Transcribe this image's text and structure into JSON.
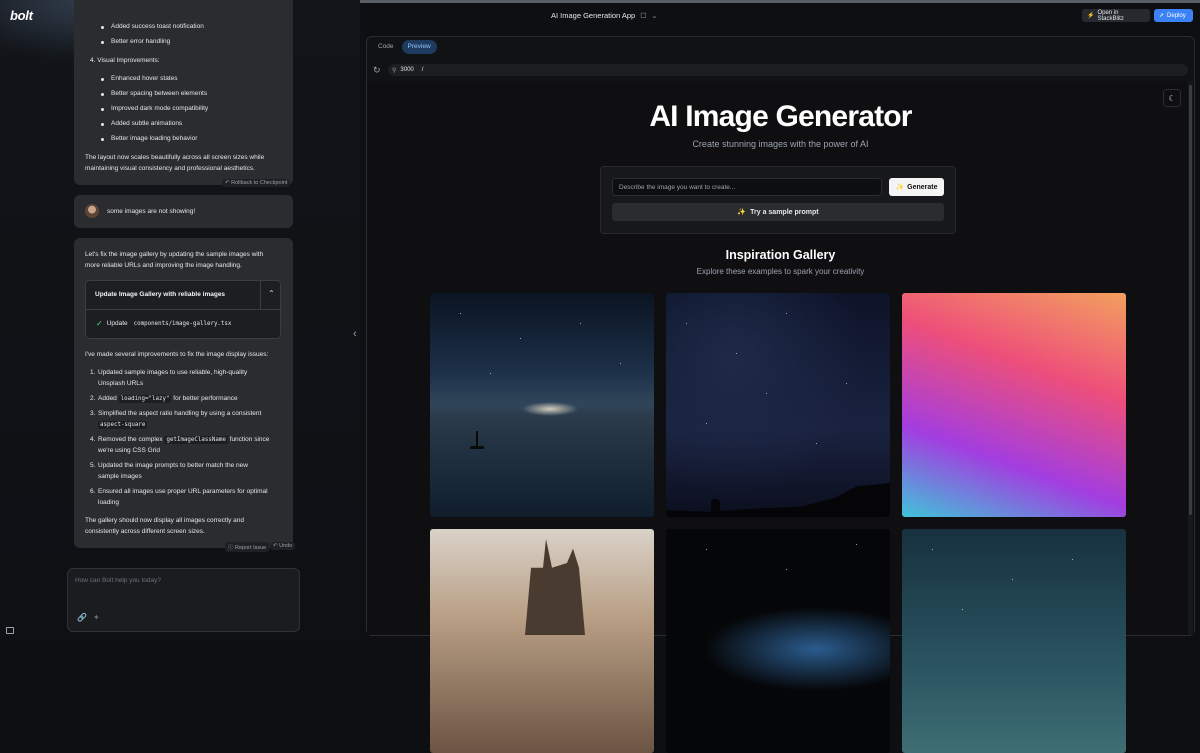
{
  "app": {
    "logo": "bolt",
    "title": "AI Image Generation App"
  },
  "header": {
    "stackblitz": "Open in StackBlitz",
    "deploy": "Deploy"
  },
  "chat": {
    "msg1": {
      "partial_item": "Added success toast notification",
      "item_error": "Better error handling",
      "section4": "4.  Visual Improvements:",
      "bullets": [
        "Enhanced hover states",
        "Better spacing between elements",
        "Improved dark mode compatibility",
        "Added subtle animations",
        "Better image loading behavior"
      ],
      "summary_l1": "The layout now scales beautifully across all screen sizes while",
      "summary_l2": "maintaining visual consistency and professional aesthetics.",
      "rollback": "Rollback to Checkpoint"
    },
    "user_msg": "some images are not showing!",
    "msg2": {
      "intro_l1": "Let's fix the image gallery by updating the sample images with",
      "intro_l2": "more reliable URLs and improving the image handling.",
      "artifact_title": "Update Image Gallery with reliable images",
      "artifact_action": "Update",
      "artifact_file": "components/image-gallery.tsx",
      "improvements_intro": "I've made several improvements to fix the image display issues:",
      "items": [
        {
          "n": "1.",
          "l1": "Updated sample images to use reliable, high-quality",
          "l2": "Unsplash URLs"
        },
        {
          "n": "2.",
          "a": "Added ",
          "code": "loading=\"lazy\"",
          "b": " for better performance"
        },
        {
          "n": "3.",
          "l1": "Simplified the aspect ratio handling by using a consistent",
          "code": "aspect-square"
        },
        {
          "n": "4.",
          "a": "Removed the complex ",
          "code": "getImageClassName",
          "b": " function since",
          "l2": "we're using CSS Grid"
        },
        {
          "n": "5.",
          "l1": "Updated the image prompts to better match the new",
          "l2": "sample images"
        },
        {
          "n": "6.",
          "l1": "Ensured all images use proper URL parameters for optimal",
          "l2": "loading"
        }
      ],
      "closing_l1": "The gallery should now display all images correctly and",
      "closing_l2": "consistently across different screen sizes.",
      "report": "Report Issue",
      "undo": "Undo"
    },
    "input_placeholder": "How can Bolt help you today?"
  },
  "preview": {
    "tabs": [
      "Code",
      "Preview"
    ],
    "active_tab": "Preview",
    "port": "3000",
    "path": "/",
    "title": "AI Image Generator",
    "subtitle": "Create stunning images with the power of AI",
    "prompt_placeholder": "Describe the image you want to create...",
    "generate": "Generate",
    "sample": "Try a sample prompt",
    "gallery_title": "Inspiration Gallery",
    "gallery_subtitle": "Explore these examples to spark your creativity"
  }
}
